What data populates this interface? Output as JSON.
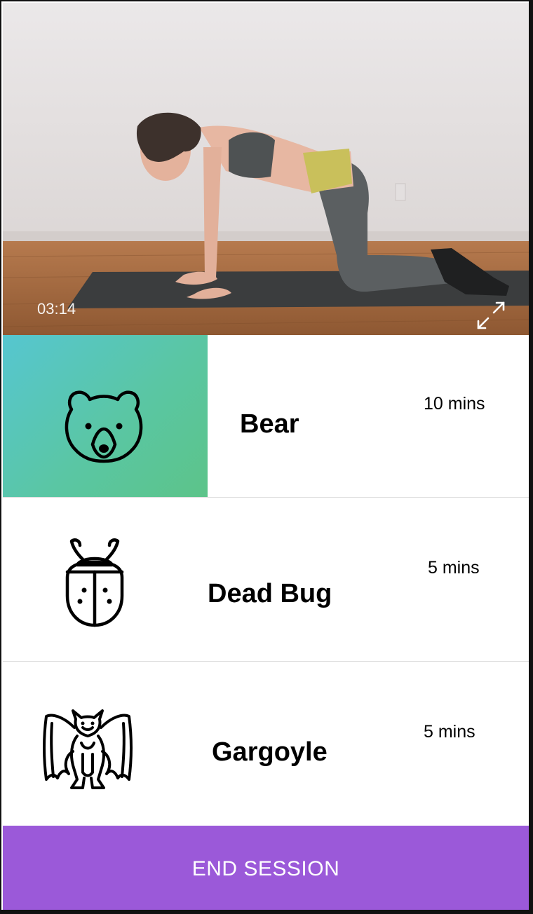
{
  "video": {
    "timecode": "03:14",
    "fullscreen_icon": "expand-arrows-icon"
  },
  "exercises": [
    {
      "name": "Bear",
      "duration": "10 mins",
      "icon": "bear-icon",
      "active": true
    },
    {
      "name": "Dead Bug",
      "duration": "5 mins",
      "icon": "beetle-icon",
      "active": false
    },
    {
      "name": "Gargoyle",
      "duration": "5 mins",
      "icon": "gargoyle-icon",
      "active": false
    }
  ],
  "actions": {
    "end_session_label": "END SESSION"
  },
  "colors": {
    "active_gradient_start": "#56c6d0",
    "active_gradient_end": "#5cc489",
    "end_button": "#9b59d9"
  }
}
